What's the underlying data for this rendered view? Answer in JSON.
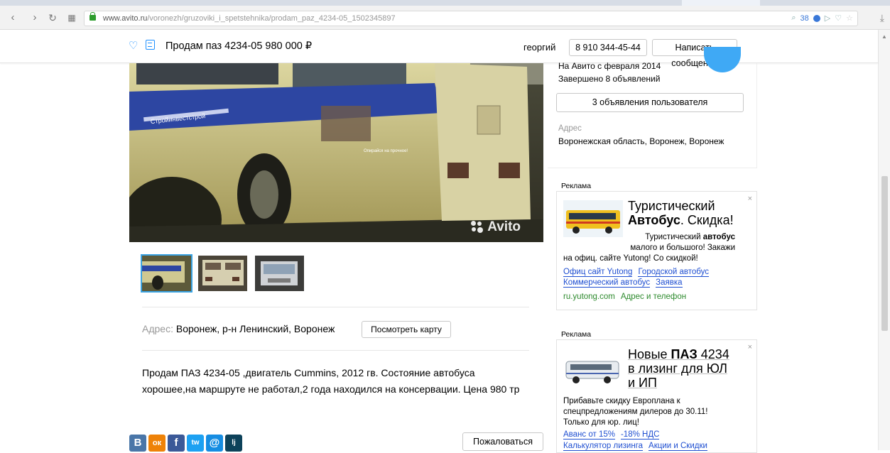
{
  "browser": {
    "url_host": "www.avito.ru",
    "url_path": "/voronezh/gruzoviki_i_spetstehnika/prodam_paz_4234-05_1502345897",
    "badge_count": "38"
  },
  "header": {
    "title": "Продам паз 4234-05   980 000 ₽",
    "seller_name": "георгий",
    "phone": "8 910 344-45-44",
    "message_button": "Написать сообщение"
  },
  "gallery": {
    "watermark": "Avito",
    "thumb_count": 3,
    "bus_text": "Стройинвестстрой",
    "bus_slogan": "Опирайся на прочное!"
  },
  "listing": {
    "address_label": "Адрес:",
    "address_value": "Воронеж, р-н Ленинский, Воронеж",
    "map_button": "Посмотреть карту",
    "description": "Продам ПАЗ 4234-05 ,двигатель Cummins, 2012 гв. Состояние автобуса хорошее,на маршруте не работал,2 года находился на консервации. Цена 980 тр",
    "complain_button": "Пожаловаться"
  },
  "social": [
    "В",
    "ок",
    "f",
    "tw",
    "@",
    "lj"
  ],
  "seller_panel": {
    "since": "На Авито с февраля 2014",
    "completed": "Завершено 8 объявлений",
    "user_ads_button": "3 объявления пользователя",
    "address_label": "Адрес",
    "address_value": "Воронежская область, Воронеж, Воронеж"
  },
  "ads": [
    {
      "label": "Реклама",
      "close": "×",
      "head_line1": "Туристический",
      "head_bold": "Автобус",
      "head_rest": ". Скидка!",
      "body_bold_prefix": "Туристический ",
      "body_bold": "автобус",
      "body_line2": "малого и большого! Закажи",
      "body_line3": "на офиц. сайте Yutong! Со скидкой!",
      "links1": [
        "Офиц сайт Yutong",
        "Городской автобус"
      ],
      "links2": [
        "Коммерческий автобус",
        "Заявка"
      ],
      "domain": "ru.yutong.com",
      "domain_link": "Адрес и телефон"
    },
    {
      "label": "Реклама",
      "close": "×",
      "head_pre": "Новые ",
      "head_bold": "ПАЗ",
      "head_post": " 4234",
      "head_line2": "в лизинг для ЮЛ",
      "head_line3": "и ИП",
      "body_line1": "Прибавьте скидку Европлана к",
      "body_line2": "спецпредложениям дилеров до 30.11!",
      "body_line3": "Только для юр. лиц!",
      "links1": [
        "Аванс от 15%",
        "-18% НДС"
      ],
      "links2": [
        "Калькулятор лизинга",
        "Акции и Скидки"
      ]
    }
  ],
  "colors": {
    "accent": "#1e90ff",
    "link": "#1f4fd1",
    "green": "#2d8a2d"
  }
}
